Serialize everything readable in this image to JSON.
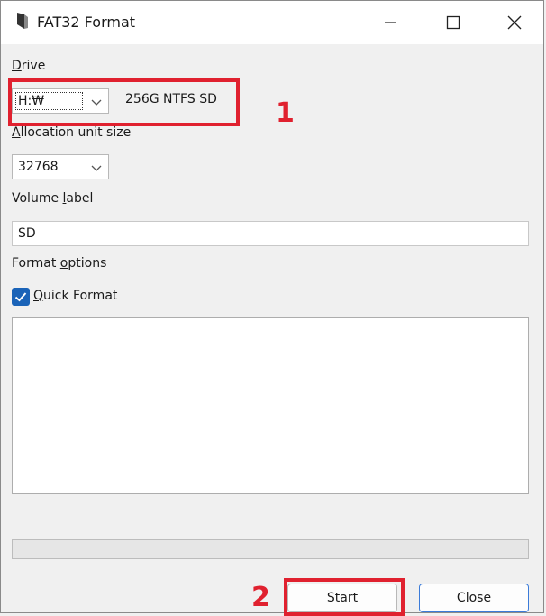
{
  "window": {
    "title": "FAT32 Format",
    "controls": {
      "minimize": "minimize-icon",
      "maximize": "maximize-icon",
      "close": "close-icon"
    }
  },
  "drive": {
    "label": "Drive",
    "label_mnemonic": "D",
    "label_rest": "rive",
    "selected": "H:₩",
    "description": "256G NTFS SD"
  },
  "allocation": {
    "label_mnemonic": "A",
    "label_rest": "llocation unit size",
    "selected": "32768"
  },
  "volume_label": {
    "label_prefix": "Volume ",
    "label_mnemonic": "l",
    "label_rest": "abel",
    "value": "SD"
  },
  "format_options": {
    "label_prefix": "Format ",
    "label_mnemonic": "o",
    "label_rest": "ptions",
    "quick_format_mnemonic": "Q",
    "quick_format_rest": "uick Format",
    "quick_format_checked": true
  },
  "log_text": "",
  "progress": 0,
  "buttons": {
    "start": "Start",
    "close": "Close"
  },
  "annotations": [
    {
      "number": "1",
      "target": "drive selection"
    },
    {
      "number": "2",
      "target": "start button"
    }
  ],
  "colors": {
    "annotation": "#e0212f",
    "checkbox": "#1a63b8",
    "focus_border": "#3b7bd9"
  }
}
